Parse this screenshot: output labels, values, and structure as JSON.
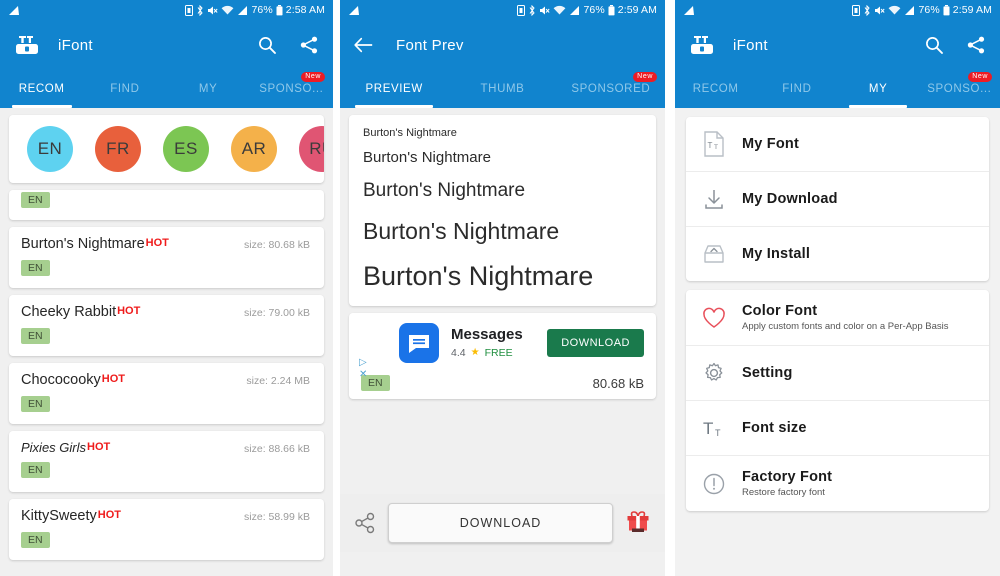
{
  "statusbar": {
    "icons": [
      "signal-wave-icon",
      "sim-icon",
      "bluetooth-icon",
      "mute-icon",
      "wifi-icon",
      "cellular-icon"
    ],
    "battery": "76%",
    "battery_icon": "battery-icon",
    "time_1": "2:58 AM",
    "time_2": "2:59 AM",
    "time_3": "2:59 AM"
  },
  "colors": {
    "primary_blue": "#1184CE",
    "tab_inactive": "#8FC8E9",
    "hot_red": "#EF1B1B",
    "badge_red": "#ED1C24",
    "chip_green": "#A6CF8F",
    "ad_green": "#1A7A4C",
    "heart_red": "#E8505B"
  },
  "panel1": {
    "app_title": "iFont",
    "logo_name": "ifont-logo",
    "search_icon": "search-icon",
    "share_icon": "share-icon",
    "tabs": [
      {
        "label": "RECOM",
        "active": true,
        "badge": null
      },
      {
        "label": "FIND",
        "active": false,
        "badge": null
      },
      {
        "label": "MY",
        "active": false,
        "badge": null
      },
      {
        "label": "SPONSO...",
        "active": false,
        "badge": "New"
      }
    ],
    "languages": [
      {
        "code": "EN",
        "color": "#5ED2F0"
      },
      {
        "code": "FR",
        "color": "#E8603C"
      },
      {
        "code": "ES",
        "color": "#7CC653"
      },
      {
        "code": "AR",
        "color": "#F4B14A"
      },
      {
        "code": "RU",
        "color": "#E05573"
      }
    ],
    "clipped_row": {
      "chip": "EN"
    },
    "fonts": [
      {
        "name": "Burton's Nightmare",
        "hot": "HOT",
        "size": "size: 80.68 kB",
        "chip": "EN"
      },
      {
        "name": "Cheeky Rabbit",
        "hot": "HOT",
        "size": "size: 79.00 kB",
        "chip": "EN"
      },
      {
        "name": "Chococooky",
        "hot": "HOT",
        "size": "size: 2.24 MB",
        "chip": "EN"
      },
      {
        "name": "Pixies Girls",
        "hot": "HOT",
        "size": "size: 88.66 kB",
        "chip": "EN"
      },
      {
        "name": "KittySweety",
        "hot": "HOT",
        "size": "size: 58.99 kB",
        "chip": "EN"
      }
    ]
  },
  "panel2": {
    "app_title": "Font Prev",
    "back_icon": "back-arrow-icon",
    "tabs": [
      {
        "label": "PREVIEW",
        "active": true,
        "badge": null
      },
      {
        "label": "THUMB",
        "active": false,
        "badge": null
      },
      {
        "label": "SPONSORED",
        "active": false,
        "badge": "New"
      }
    ],
    "preview_lines": [
      "Burton's Nightmare",
      "Burton's Nightmare",
      "Burton's Nightmare",
      "Burton's Nightmare",
      "Burton's Nightmare"
    ],
    "ad": {
      "icon_name": "messages-app-icon",
      "title": "Messages",
      "rating": "4.4",
      "star_icon": "star-icon",
      "price": "FREE",
      "cta": "DOWNLOAD",
      "adchoices_icon": "adchoices-icon",
      "close_icon": "ad-close-icon",
      "chip": "EN",
      "size": "80.68 kB"
    },
    "bottom": {
      "share_icon": "share-icon",
      "download_label": "DOWNLOAD",
      "gift_icon": "gift-icon"
    }
  },
  "panel3": {
    "app_title": "iFont",
    "logo_name": "ifont-logo",
    "search_icon": "search-icon",
    "share_icon": "share-icon",
    "tabs": [
      {
        "label": "RECOM",
        "active": false,
        "badge": null
      },
      {
        "label": "FIND",
        "active": false,
        "badge": null
      },
      {
        "label": "MY",
        "active": true,
        "badge": null
      },
      {
        "label": "SPONSO...",
        "active": false,
        "badge": "New"
      }
    ],
    "group1": [
      {
        "title": "My Font",
        "sub": "",
        "icon": "font-file-icon"
      },
      {
        "title": "My Download",
        "sub": "",
        "icon": "download-icon"
      },
      {
        "title": "My Install",
        "sub": "",
        "icon": "install-box-icon"
      }
    ],
    "group2": [
      {
        "title": "Color Font",
        "sub": "Apply custom fonts and color on a Per-App Basis",
        "icon": "heart-icon"
      },
      {
        "title": "Setting",
        "sub": "",
        "icon": "gear-icon"
      },
      {
        "title": "Font size",
        "sub": "",
        "icon": "font-size-icon"
      },
      {
        "title": "Factory Font",
        "sub": "Restore factory font",
        "icon": "exclamation-circle-icon"
      }
    ]
  }
}
